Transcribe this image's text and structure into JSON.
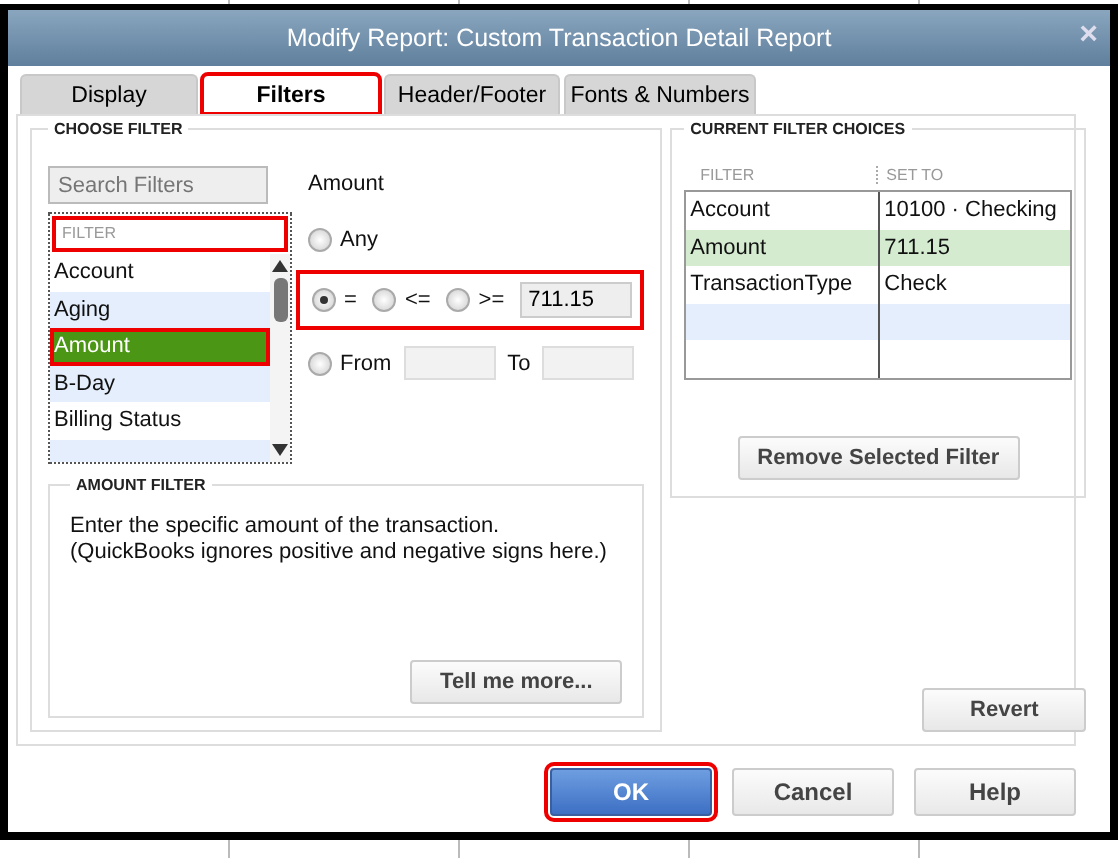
{
  "window": {
    "title": "Modify Report: Custom Transaction Detail Report",
    "close": "×"
  },
  "tabs": [
    {
      "label": "Display",
      "selected": false,
      "highlighted": false
    },
    {
      "label": "Filters",
      "selected": true,
      "highlighted": true
    },
    {
      "label": "Header/Footer",
      "selected": false,
      "highlighted": false
    },
    {
      "label": "Fonts & Numbers",
      "selected": false,
      "highlighted": false
    }
  ],
  "choose_filter": {
    "heading": "CHOOSE FILTER",
    "search": {
      "placeholder": "Search Filters"
    },
    "list_header": {
      "label": "FILTER",
      "highlighted": true
    },
    "items": [
      {
        "label": "Account",
        "selected": false,
        "highlighted": false
      },
      {
        "label": "Aging",
        "selected": false,
        "highlighted": false
      },
      {
        "label": "Amount",
        "selected": true,
        "highlighted": true
      },
      {
        "label": "B-Day",
        "selected": false,
        "highlighted": false
      },
      {
        "label": "Billing Status",
        "selected": false,
        "highlighted": false
      }
    ],
    "field_label": "Amount",
    "any": {
      "label": "Any",
      "selected": false
    },
    "comparison": {
      "highlighted": true,
      "options": [
        {
          "label": "=",
          "selected": true
        },
        {
          "label": "<=",
          "selected": false
        },
        {
          "label": ">=",
          "selected": false
        }
      ],
      "value": "711.15"
    },
    "range": {
      "label": "From",
      "selected": false,
      "to_label": "To"
    }
  },
  "amount_filter": {
    "heading": "AMOUNT FILTER",
    "text": "Enter the specific amount of the transaction. (QuickBooks ignores positive and negative signs here.)",
    "button": "Tell me more..."
  },
  "current_filters": {
    "heading": "CURRENT FILTER CHOICES",
    "columns": [
      "FILTER",
      "SET TO"
    ],
    "rows": [
      {
        "filter": "Account",
        "set_to": "10100 · Checking",
        "selected": false
      },
      {
        "filter": "Amount",
        "set_to": "711.15",
        "selected": true
      },
      {
        "filter": "TransactionType",
        "set_to": "Check",
        "selected": false
      }
    ],
    "button": "Remove Selected Filter"
  },
  "revert_button": "Revert",
  "buttons": [
    {
      "label": "OK",
      "kind": "primary",
      "highlighted": true
    },
    {
      "label": "Cancel",
      "kind": "normal",
      "highlighted": false
    },
    {
      "label": "Help",
      "kind": "normal",
      "highlighted": false
    }
  ]
}
